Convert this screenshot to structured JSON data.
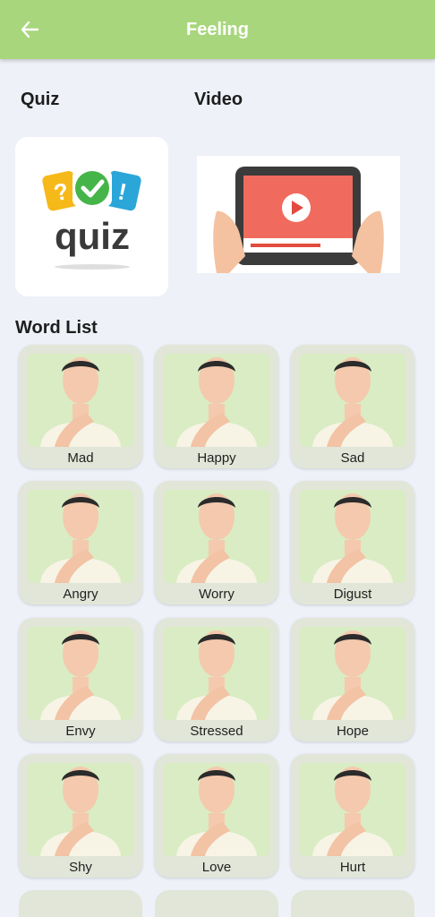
{
  "appbar": {
    "title": "Feeling",
    "back_icon": "arrow-left-icon",
    "bg": "#a8d67c"
  },
  "sections": {
    "quiz_label": "Quiz",
    "video_label": "Video",
    "word_list_label": "Word List"
  },
  "quiz_card": {
    "logo_text": "quiz",
    "icons": [
      "question-icon",
      "check-icon",
      "exclamation-icon"
    ]
  },
  "video_card": {
    "icon": "play-icon"
  },
  "words": [
    {
      "label": "Mad"
    },
    {
      "label": "Happy"
    },
    {
      "label": "Sad"
    },
    {
      "label": "Angry"
    },
    {
      "label": "Worry"
    },
    {
      "label": "Digust"
    },
    {
      "label": "Envy"
    },
    {
      "label": "Stressed"
    },
    {
      "label": "Hope"
    },
    {
      "label": "Shy"
    },
    {
      "label": "Love"
    },
    {
      "label": "Hurt"
    }
  ]
}
